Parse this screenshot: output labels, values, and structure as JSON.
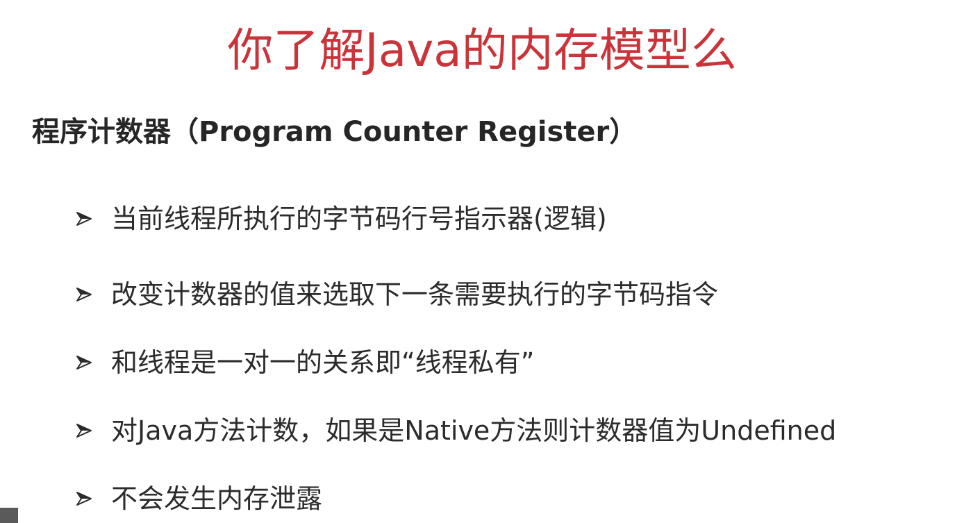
{
  "slide": {
    "title": "你了解Java的内存模型么",
    "subtitle": "程序计数器（Program Counter Register）",
    "bullets": [
      {
        "text": "当前线程所执行的字节码行号指示器(逻辑)",
        "marker": "arrowhead-bullet-icon"
      },
      {
        "text": "改变计数器的值来选取下一条需要执行的字节码指令",
        "marker": "arrowhead-bullet-icon"
      },
      {
        "text": "和线程是一对一的关系即“线程私有”",
        "marker": "arrowhead-bullet-icon"
      },
      {
        "text": "对Java方法计数，如果是Native方法则计数器值为Undefined",
        "marker": "arrowhead-bullet-icon"
      },
      {
        "text": "不会发生内存泄露",
        "marker": "arrowhead-bullet-icon"
      }
    ],
    "colors": {
      "title": "#c9343a",
      "text": "#2b2b2b"
    }
  }
}
